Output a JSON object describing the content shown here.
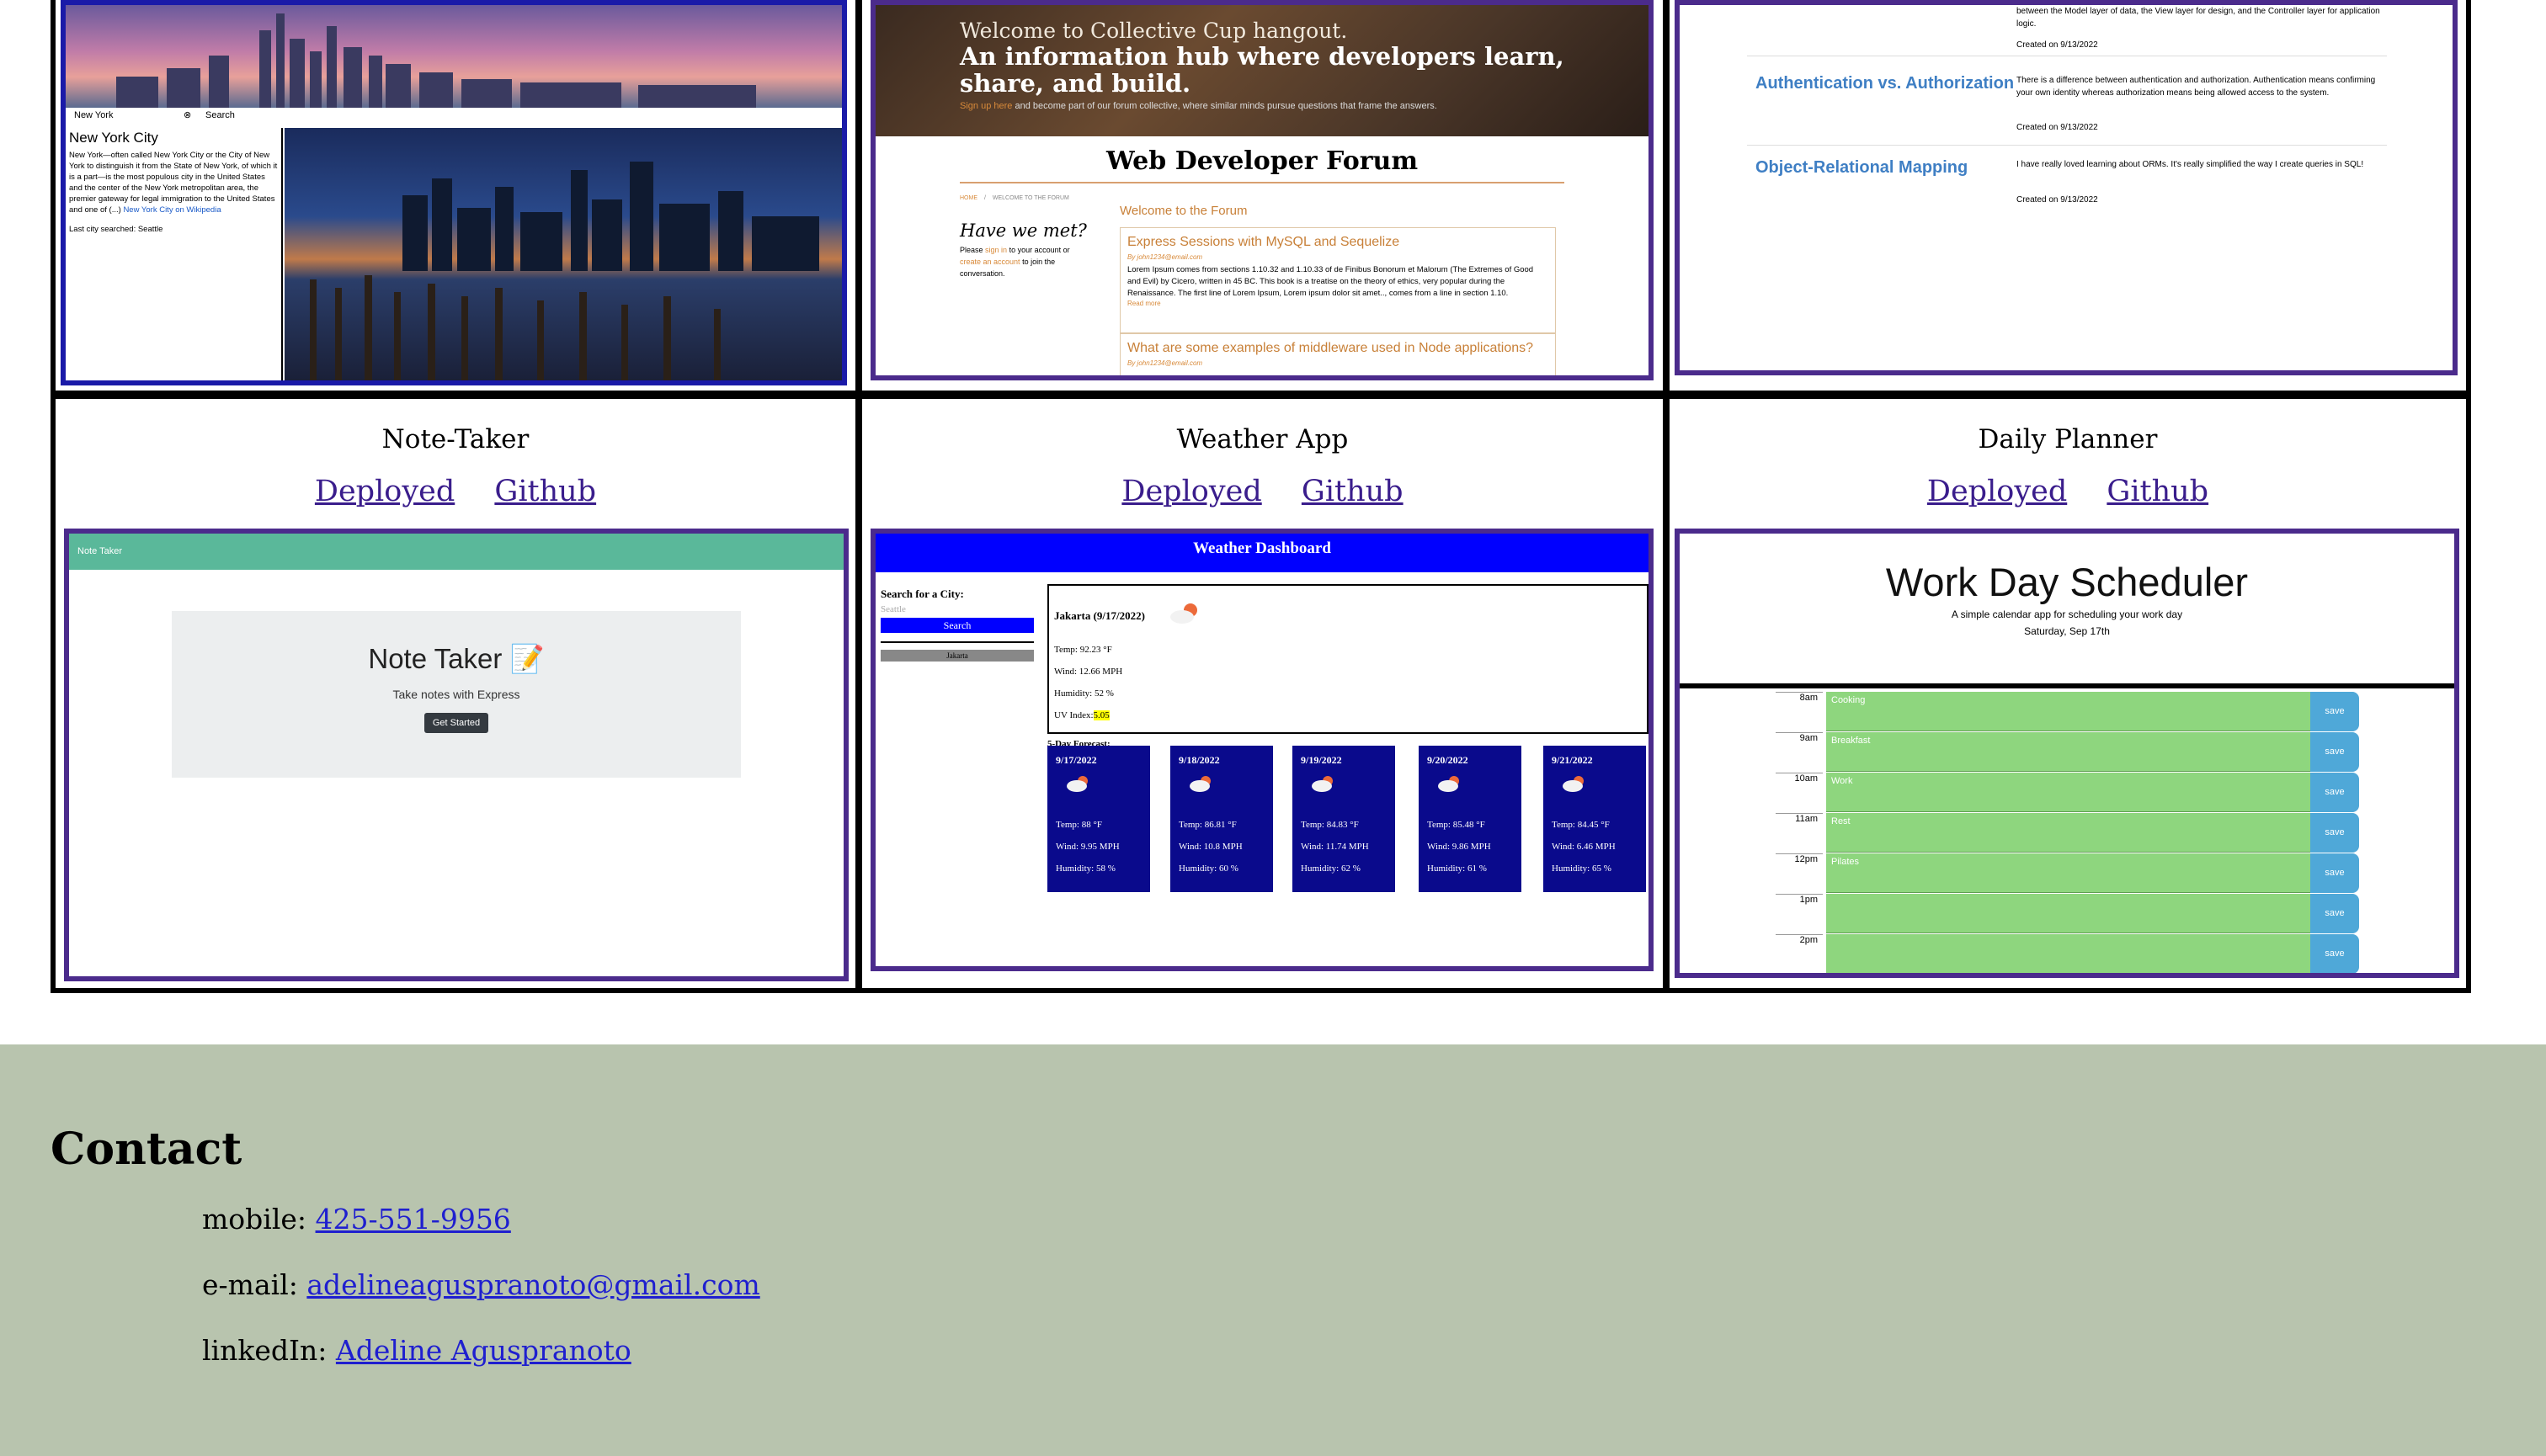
{
  "seattle_card": {
    "search_value": "New York",
    "search_button": "Search",
    "city_title": "New York City",
    "city_text": "New York—often called New York City or the City of New York to distinguish it from the State of New York, of which it is a part—is the most populous city in the United States and the center of the New York metropolitan area, the premier gateway for legal immigration to the United States and one of (...)",
    "wiki_link": "New York City on Wikipedia",
    "last_search": "Last city searched: Seattle"
  },
  "forum_card": {
    "hero_line1": "Welcome to Collective Cup hangout.",
    "hero_line2": "An information hub where developers learn,",
    "hero_line3": "share, and build.",
    "hero_sub_link": "Sign up here",
    "hero_sub": "and become part of our forum collective, where similar minds pursue questions that frame the answers.",
    "title": "Web Developer Forum",
    "breadcrumb_home": "HOME",
    "breadcrumb_current": "WELCOME TO THE FORUM",
    "aside_heading": "Have we met?",
    "aside_text_1": "Please",
    "aside_sign_in": "sign in",
    "aside_text_2": "to your account or",
    "aside_create": "create an account",
    "aside_text_3": "to join the conversation.",
    "welcome": "Welcome to the Forum",
    "post1_title": "Express Sessions with MySQL and Sequelize",
    "post1_by": "By john1234@email.com",
    "post1_body": "Lorem Ipsum comes from sections 1.10.32 and 1.10.33 of de Finibus Bonorum et Malorum (The Extremes of Good and Evil) by Cicero, written in 45 BC. This book is a treatise on the theory of ethics, very popular during the Renaissance. The first line of Lorem Ipsum, Lorem ipsum dolor sit amet.., comes from a line in section 1.10.",
    "post1_more": "Read more",
    "post2_title": "What are some examples of middleware used in Node applications?",
    "post2_by": "By john1234@email.com"
  },
  "blog_card": {
    "row0_text": "between the Model layer of data, the View layer for design, and the Controller layer for application logic.",
    "row0_date": "Created on 9/13/2022",
    "row1_title": "Authentication vs. Authorization",
    "row1_text": "There is a difference between authentication and authorization. Authentication means confirming your own identity whereas authorization means being allowed access to the system.",
    "row1_date": "Created on 9/13/2022",
    "row2_title": "Object-Relational Mapping",
    "row2_text": "I have really loved learning about ORMs. It's really simplified the way I create queries in SQL!",
    "row2_date": "Created on 9/13/2022"
  },
  "projects": [
    {
      "title": "Note-Taker",
      "deployed": "Deployed",
      "github": "Github"
    },
    {
      "title": "Weather App",
      "deployed": "Deployed",
      "github": "Github"
    },
    {
      "title": "Daily Planner",
      "deployed": "Deployed",
      "github": "Github"
    }
  ],
  "note_taker": {
    "navbar": "Note Taker",
    "heading": "Note Taker 📝",
    "subtitle": "Take notes with Express",
    "button": "Get Started"
  },
  "weather": {
    "header": "Weather Dashboard",
    "search_label": "Search for a City:",
    "search_placeholder": "Seattle",
    "search_button": "Search",
    "history_item": "Jakarta",
    "current_title": "Jakarta (9/17/2022)",
    "current_temp": "Temp: 92.23 °F",
    "current_wind": "Wind: 12.66 MPH",
    "current_humidity": "Humidity: 52 %",
    "uv_label": "UV Index:",
    "uv_value": "5.05",
    "forecast_label": "5-Day Forecast:",
    "forecast": [
      {
        "date": "9/17/2022",
        "temp": "Temp: 88 °F",
        "wind": "Wind: 9.95 MPH",
        "humidity": "Humidity: 58 %"
      },
      {
        "date": "9/18/2022",
        "temp": "Temp: 86.81 °F",
        "wind": "Wind: 10.8 MPH",
        "humidity": "Humidity: 60 %"
      },
      {
        "date": "9/19/2022",
        "temp": "Temp: 84.83 °F",
        "wind": "Wind: 11.74 MPH",
        "humidity": "Humidity: 62 %"
      },
      {
        "date": "9/20/2022",
        "temp": "Temp: 85.48 °F",
        "wind": "Wind: 9.86 MPH",
        "humidity": "Humidity: 61 %"
      },
      {
        "date": "9/21/2022",
        "temp": "Temp: 84.45 °F",
        "wind": "Wind: 6.46 MPH",
        "humidity": "Humidity: 65 %"
      }
    ],
    "colors": {
      "header": "#0000ff",
      "card": "#0a0a8c"
    }
  },
  "scheduler": {
    "title": "Work Day Scheduler",
    "subtitle": "A simple calendar app for scheduling your work day",
    "date": "Saturday, Sep 17th",
    "rows": [
      {
        "hour": "8am",
        "text": "Cooking",
        "save": "save"
      },
      {
        "hour": "9am",
        "text": "Breakfast",
        "save": "save"
      },
      {
        "hour": "10am",
        "text": "Work",
        "save": "save"
      },
      {
        "hour": "11am",
        "text": "Rest",
        "save": "save"
      },
      {
        "hour": "12pm",
        "text": "Pilates",
        "save": "save"
      },
      {
        "hour": "1pm",
        "text": "",
        "save": "save"
      },
      {
        "hour": "2pm",
        "text": "",
        "save": "save"
      }
    ],
    "colors": {
      "future": "#8ed67e",
      "save": "#4fa8d8"
    }
  },
  "contact": {
    "heading": "Contact",
    "mobile_label": "mobile:",
    "mobile_value": "425-551-9956",
    "email_label": "e-mail:",
    "email_value": "adelineaguspranoto@gmail.com",
    "linkedin_label": "linkedIn:",
    "linkedin_value": "Adeline Aguspranoto",
    "background": "#b8c4ae"
  }
}
